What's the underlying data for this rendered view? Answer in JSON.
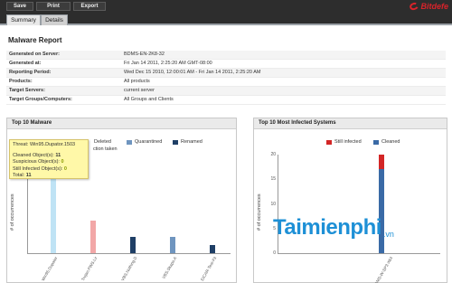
{
  "toolbar": {
    "save": "Save",
    "print": "Print",
    "export": "Export"
  },
  "brand": {
    "name": "Bitdefe"
  },
  "tabs": [
    {
      "label": "Summary",
      "active": true
    },
    {
      "label": "Details",
      "active": false
    }
  ],
  "report": {
    "title": "Malware Report",
    "rows": [
      {
        "label": "Generated on Server:",
        "value": "BDMS-EN-2K8-32"
      },
      {
        "label": "Generated at:",
        "value": "Fri Jan 14 2011, 2:25:20 AM GMT-08:00"
      },
      {
        "label": "Reporting Period:",
        "value": "Wed Dec 15 2010, 12:00:01 AM - Fri Jan 14 2011, 2:25:20 AM"
      },
      {
        "label": "Products:",
        "value": "All products"
      },
      {
        "label": "Target Servers:",
        "value": "current server"
      },
      {
        "label": "Target Groups/Computers:",
        "value": "All Groups and Clients"
      }
    ]
  },
  "malware_panel": {
    "title": "Top 10 Malware",
    "legend": {
      "deleted": "Deleted",
      "quarantined": "Quarantined",
      "renamed": "Renamed",
      "partial_action": "ction taken"
    },
    "y_label": "# of occurrences",
    "tooltip": {
      "threat_label": "Threat:",
      "threat_name": "Win95.Dupator.1503",
      "cleaned_label": "Cleaned Object(s):",
      "cleaned_value": "11",
      "suspicious_label": "Suspicious Object(s):",
      "suspicious_value": "0",
      "still_label": "Still Infected Object(s):",
      "still_value": "0",
      "total_label": "Total:",
      "total_value": "11"
    }
  },
  "infected_panel": {
    "title": "Top 10 Most Infected Systems",
    "legend": {
      "still_infected": "Still infected",
      "cleaned": "Cleaned"
    },
    "y_label": "# of occurrences"
  },
  "colors": {
    "cleaned_light": "#bfe3f5",
    "no_action": "#f2a7a7",
    "quarantined": "#6f95bf",
    "renamed": "#1f3f66",
    "still_infected": "#d32626",
    "cleaned": "#3a6aa6",
    "tooltip_bg": "#fff8a8",
    "watermark": "#1e90d6"
  },
  "chart_data": [
    {
      "type": "bar",
      "title": "Top 10 Malware",
      "ylabel": "# of occurrences",
      "categories": [
        "Win95.Dupator.1503",
        "Trojan.PWS.Lineage",
        "VBS.Nothing.D",
        "VBS.Skapo.A",
        "EICAR-Test-File"
      ],
      "values": [
        11,
        4,
        2,
        2,
        1
      ],
      "bar_colors": [
        "#bfe3f5",
        "#f2a7a7",
        "#1f3f66",
        "#6f95bf",
        "#1f3f66"
      ],
      "ylim": [
        0,
        12
      ]
    },
    {
      "type": "bar",
      "title": "Top 10 Most Infected Systems",
      "ylabel": "# of occurrences",
      "categories": [
        "BDMS-W-SP3-X64"
      ],
      "series": [
        {
          "name": "Cleaned",
          "values": [
            17
          ]
        },
        {
          "name": "Still infected",
          "values": [
            3
          ]
        }
      ],
      "ylim": [
        0,
        20
      ]
    }
  ]
}
